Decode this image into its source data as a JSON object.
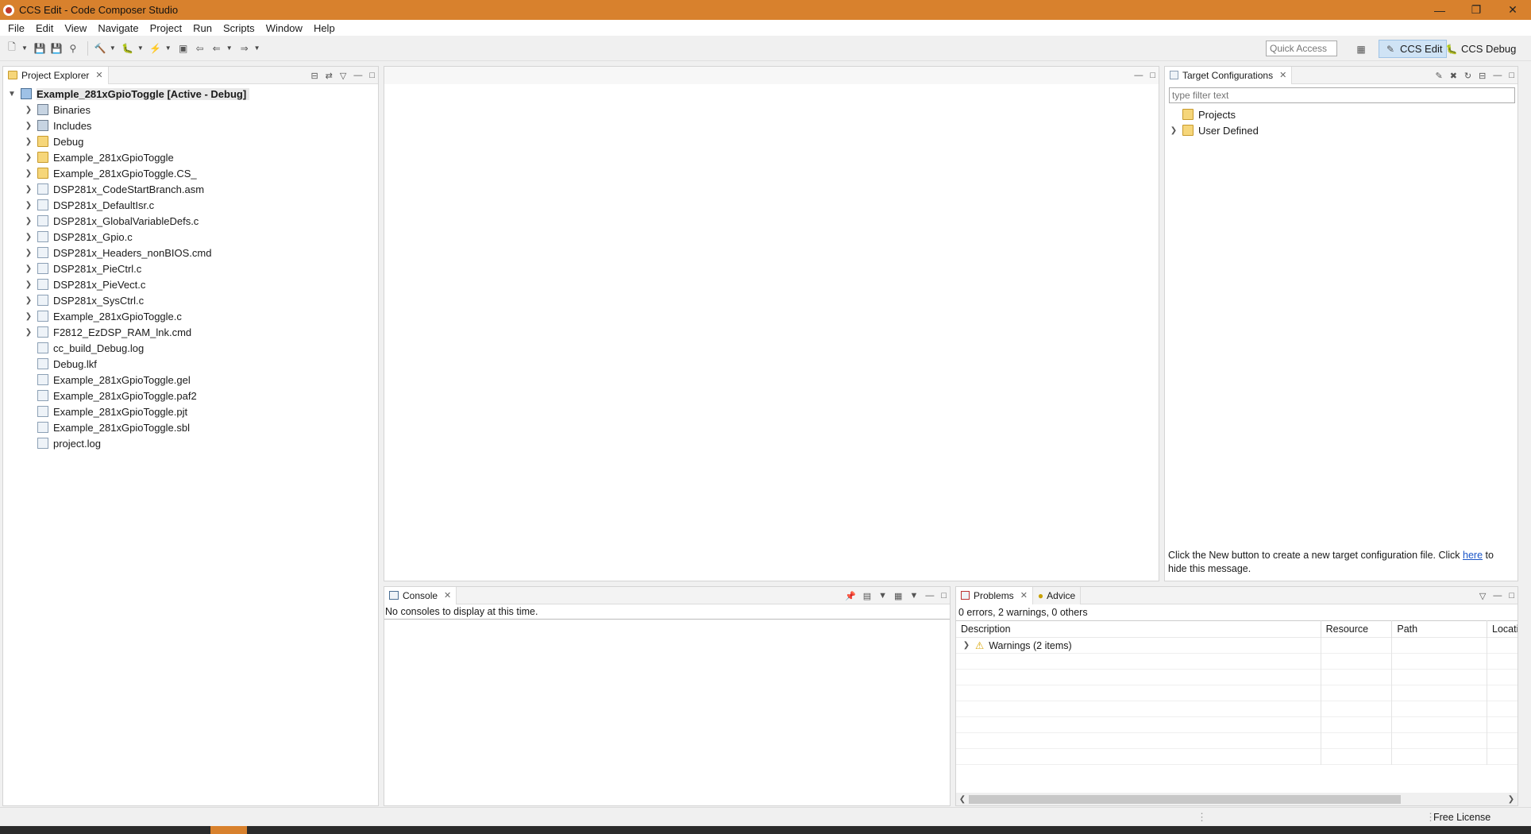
{
  "window": {
    "title": "CCS Edit - Code Composer Studio"
  },
  "menu": [
    "File",
    "Edit",
    "View",
    "Navigate",
    "Project",
    "Run",
    "Scripts",
    "Window",
    "Help"
  ],
  "toolbar": {
    "quick_access_placeholder": "Quick Access"
  },
  "perspectives": {
    "edit": "CCS Edit",
    "debug": "CCS Debug"
  },
  "project_explorer": {
    "tab_label": "Project Explorer",
    "project": "Example_281xGpioToggle  [Active - Debug]",
    "items": [
      {
        "label": "Binaries",
        "icon": "binaries-icon",
        "expandable": true
      },
      {
        "label": "Includes",
        "icon": "includes-icon",
        "expandable": true
      },
      {
        "label": "Debug",
        "icon": "folder-icon",
        "expandable": true
      },
      {
        "label": "Example_281xGpioToggle",
        "icon": "folder-icon",
        "expandable": true
      },
      {
        "label": "Example_281xGpioToggle.CS_",
        "icon": "folder-icon",
        "expandable": true
      },
      {
        "label": "DSP281x_CodeStartBranch.asm",
        "icon": "asm-file-icon",
        "expandable": true
      },
      {
        "label": "DSP281x_DefaultIsr.c",
        "icon": "c-file-icon",
        "expandable": true
      },
      {
        "label": "DSP281x_GlobalVariableDefs.c",
        "icon": "c-file-icon",
        "expandable": true
      },
      {
        "label": "DSP281x_Gpio.c",
        "icon": "c-file-icon",
        "expandable": true
      },
      {
        "label": "DSP281x_Headers_nonBIOS.cmd",
        "icon": "cmd-file-icon",
        "expandable": true
      },
      {
        "label": "DSP281x_PieCtrl.c",
        "icon": "c-file-icon",
        "expandable": true
      },
      {
        "label": "DSP281x_PieVect.c",
        "icon": "c-file-icon",
        "expandable": true
      },
      {
        "label": "DSP281x_SysCtrl.c",
        "icon": "c-file-icon",
        "expandable": true
      },
      {
        "label": "Example_281xGpioToggle.c",
        "icon": "c-file-icon",
        "expandable": true
      },
      {
        "label": "F2812_EzDSP_RAM_lnk.cmd",
        "icon": "cmd-file-icon",
        "expandable": true
      },
      {
        "label": "cc_build_Debug.log",
        "icon": "text-file-icon",
        "expandable": false
      },
      {
        "label": "Debug.lkf",
        "icon": "text-file-icon",
        "expandable": false
      },
      {
        "label": "Example_281xGpioToggle.gel",
        "icon": "text-file-icon",
        "expandable": false
      },
      {
        "label": "Example_281xGpioToggle.paf2",
        "icon": "text-file-icon",
        "expandable": false
      },
      {
        "label": "Example_281xGpioToggle.pjt",
        "icon": "text-file-icon",
        "expandable": false
      },
      {
        "label": "Example_281xGpioToggle.sbl",
        "icon": "text-file-icon",
        "expandable": false
      },
      {
        "label": "project.log",
        "icon": "text-file-icon",
        "expandable": false
      }
    ]
  },
  "target_configurations": {
    "tab_label": "Target Configurations",
    "filter_placeholder": "type filter text",
    "items": [
      {
        "label": "Projects",
        "expandable": false
      },
      {
        "label": "User Defined",
        "expandable": true
      }
    ],
    "message_before": "Click the New button to create a new target configuration file. Click ",
    "message_link": "here",
    "message_after": " to hide this message."
  },
  "console": {
    "tab_label": "Console",
    "message": "No consoles to display at this time."
  },
  "problems": {
    "tab_label": "Problems",
    "advice_tab_label": "Advice",
    "summary": "0 errors, 2 warnings, 0 others",
    "columns": [
      "Description",
      "Resource",
      "Path",
      "Locati"
    ],
    "rows": [
      {
        "description": "Warnings (2 items)"
      }
    ]
  },
  "status": {
    "license": "Free License"
  }
}
